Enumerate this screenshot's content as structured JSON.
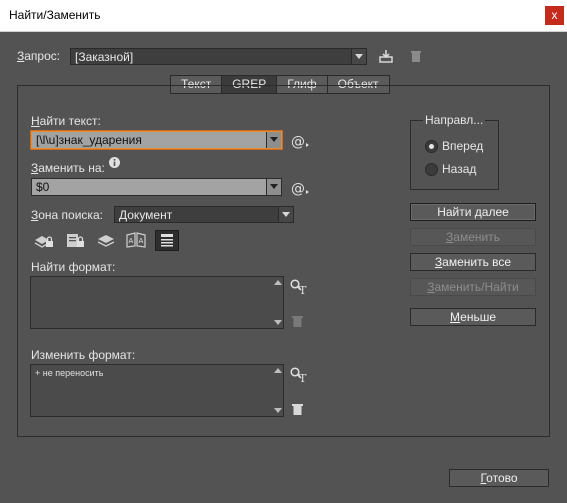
{
  "window": {
    "title": "Найти/Заменить",
    "close_glyph": "x"
  },
  "query": {
    "label_underlined": "З",
    "label_rest": "апрос:",
    "value": "[Заказной]"
  },
  "tabs": [
    {
      "label": "Текст",
      "active": false
    },
    {
      "label": "GREP",
      "active": true
    },
    {
      "label": "Глиф",
      "active": false
    },
    {
      "label": "Объект",
      "active": false
    }
  ],
  "find": {
    "label_underlined": "Н",
    "label_rest": "айти текст:",
    "value": "[\\l\\u]знак_ударения"
  },
  "replace": {
    "label_underlined": "З",
    "label_rest": "аменить на:",
    "value": "$0"
  },
  "search_zone": {
    "label_underlined": "З",
    "label_rest": "она поиска:",
    "value": "Документ"
  },
  "find_format": {
    "label": "Найти формат:"
  },
  "change_format": {
    "label": "Изменить формат:",
    "items": [
      "+ не переносить"
    ]
  },
  "direction": {
    "title": "Направл...",
    "options": [
      {
        "label": "Вперед",
        "selected": true
      },
      {
        "label": "Назад",
        "selected": false
      }
    ]
  },
  "buttons": {
    "find_next_pre": "Найти ",
    "find_next_u": "д",
    "find_next_post": "алее",
    "replace_u": "З",
    "replace_rest": "аменить",
    "replace_all_u": "З",
    "replace_all_rest": "аменить все",
    "replace_find_u": "З",
    "replace_find_rest": "аменить/Найти",
    "less_u": "М",
    "less_rest": "еньше",
    "done_u": "Г",
    "done_rest": "отово"
  },
  "icons": {
    "save_query": "save-query-icon",
    "delete_query": "trash-icon",
    "special_chars": "at-sign-menu-icon",
    "info": "info-icon",
    "locked_layers": "locked-layers-icon",
    "locked_stories": "locked-stories-icon",
    "hidden_layers": "hidden-layers-icon",
    "master_pages": "master-pages-icon",
    "footnotes": "footnotes-icon",
    "specify_format": "specify-format-icon"
  },
  "colors": {
    "focus_border": "#e58a35",
    "background": "#535353"
  }
}
